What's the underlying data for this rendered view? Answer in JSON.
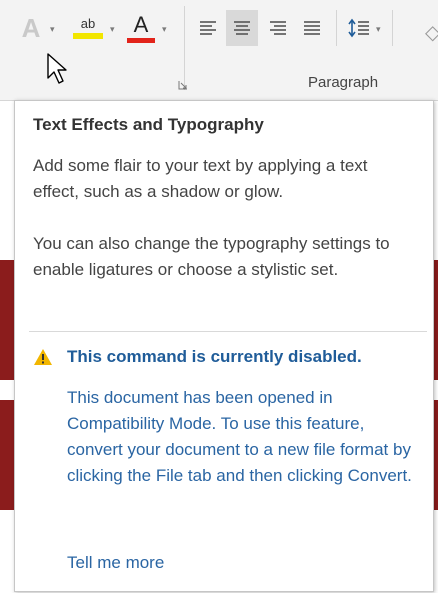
{
  "ribbon": {
    "group_label": "Paragraph",
    "text_effects_glyph": "A",
    "highlight_glyph": "ab",
    "font_color_glyph": "A",
    "highlight_color": "#f2e600",
    "font_color": "#e2231a",
    "icons": [
      "text-effects-icon",
      "highlight-icon",
      "font-color-icon",
      "align-left-icon",
      "align-center-icon",
      "align-right-icon",
      "justify-icon",
      "line-spacing-icon",
      "dialog-launcher-icon",
      "cursor-icon"
    ]
  },
  "tooltip": {
    "title": "Text Effects and Typography",
    "body_1": "Add some flair to your text by applying a text effect, such as a shadow or glow.",
    "body_2": "You can also change the typography settings to enable ligatures or choose a stylistic set.",
    "warning_title": "This command is currently disabled.",
    "warning_body": "This document has been opened in Compatibility Mode. To use this feature, convert your document to a new file format by clicking the File tab and then clicking Convert.",
    "tell_more": "Tell me more",
    "warning_color": "#1f5c99",
    "warning_icon_color": "#f2b600"
  }
}
